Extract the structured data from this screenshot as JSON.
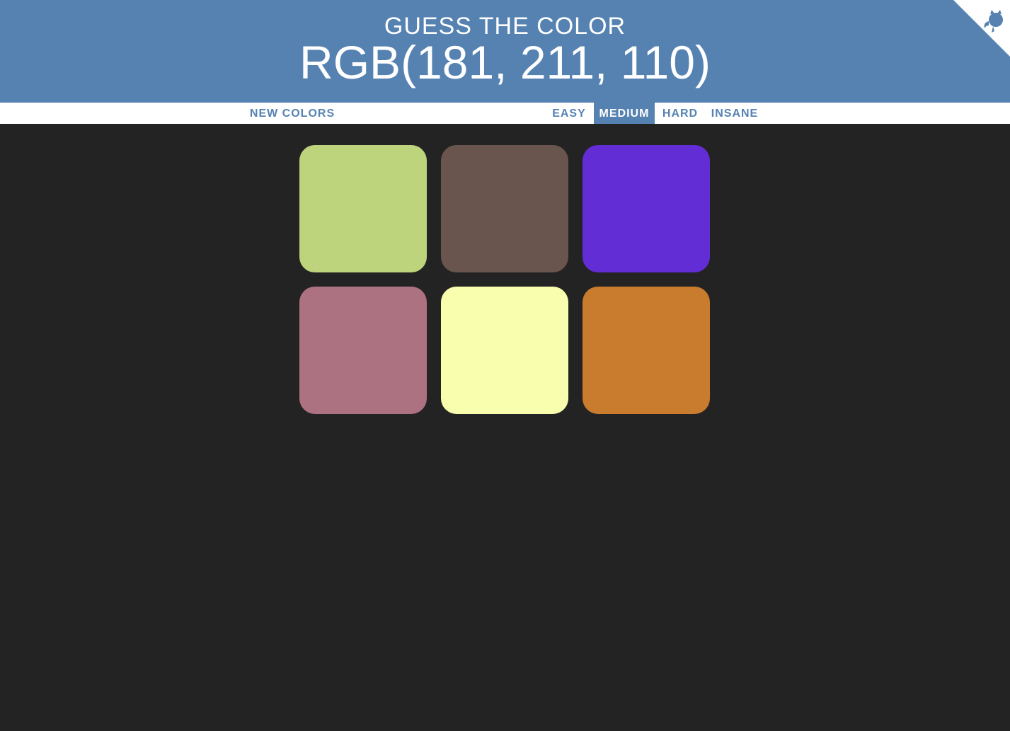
{
  "header": {
    "title": "GUESS THE COLOR",
    "target_rgb": "RGB(181, 211, 110)"
  },
  "stripe": {
    "new_colors": "NEW COLORS",
    "modes": [
      "EASY",
      "MEDIUM",
      "HARD",
      "INSANE"
    ],
    "selected_mode": "MEDIUM"
  },
  "squares": [
    {
      "color": "#bdd37c"
    },
    {
      "color": "#69554d"
    },
    {
      "color": "#622dd4"
    },
    {
      "color": "#ad7282"
    },
    {
      "color": "#f8fead"
    },
    {
      "color": "#c97b2e"
    }
  ],
  "colors": {
    "header_bg": "#5682b2",
    "page_bg": "#232323",
    "stripe_bg": "#ffffff"
  },
  "icons": {
    "corner": "github-octocat-icon"
  }
}
